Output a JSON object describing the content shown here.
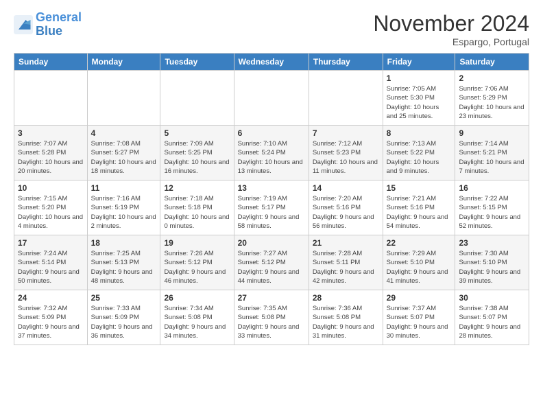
{
  "logo": {
    "line1": "General",
    "line2": "Blue"
  },
  "title": "November 2024",
  "location": "Espargo, Portugal",
  "days_header": [
    "Sunday",
    "Monday",
    "Tuesday",
    "Wednesday",
    "Thursday",
    "Friday",
    "Saturday"
  ],
  "weeks": [
    [
      {
        "day": "",
        "info": ""
      },
      {
        "day": "",
        "info": ""
      },
      {
        "day": "",
        "info": ""
      },
      {
        "day": "",
        "info": ""
      },
      {
        "day": "",
        "info": ""
      },
      {
        "day": "1",
        "info": "Sunrise: 7:05 AM\nSunset: 5:30 PM\nDaylight: 10 hours and 25 minutes."
      },
      {
        "day": "2",
        "info": "Sunrise: 7:06 AM\nSunset: 5:29 PM\nDaylight: 10 hours and 23 minutes."
      }
    ],
    [
      {
        "day": "3",
        "info": "Sunrise: 7:07 AM\nSunset: 5:28 PM\nDaylight: 10 hours and 20 minutes."
      },
      {
        "day": "4",
        "info": "Sunrise: 7:08 AM\nSunset: 5:27 PM\nDaylight: 10 hours and 18 minutes."
      },
      {
        "day": "5",
        "info": "Sunrise: 7:09 AM\nSunset: 5:25 PM\nDaylight: 10 hours and 16 minutes."
      },
      {
        "day": "6",
        "info": "Sunrise: 7:10 AM\nSunset: 5:24 PM\nDaylight: 10 hours and 13 minutes."
      },
      {
        "day": "7",
        "info": "Sunrise: 7:12 AM\nSunset: 5:23 PM\nDaylight: 10 hours and 11 minutes."
      },
      {
        "day": "8",
        "info": "Sunrise: 7:13 AM\nSunset: 5:22 PM\nDaylight: 10 hours and 9 minutes."
      },
      {
        "day": "9",
        "info": "Sunrise: 7:14 AM\nSunset: 5:21 PM\nDaylight: 10 hours and 7 minutes."
      }
    ],
    [
      {
        "day": "10",
        "info": "Sunrise: 7:15 AM\nSunset: 5:20 PM\nDaylight: 10 hours and 4 minutes."
      },
      {
        "day": "11",
        "info": "Sunrise: 7:16 AM\nSunset: 5:19 PM\nDaylight: 10 hours and 2 minutes."
      },
      {
        "day": "12",
        "info": "Sunrise: 7:18 AM\nSunset: 5:18 PM\nDaylight: 10 hours and 0 minutes."
      },
      {
        "day": "13",
        "info": "Sunrise: 7:19 AM\nSunset: 5:17 PM\nDaylight: 9 hours and 58 minutes."
      },
      {
        "day": "14",
        "info": "Sunrise: 7:20 AM\nSunset: 5:16 PM\nDaylight: 9 hours and 56 minutes."
      },
      {
        "day": "15",
        "info": "Sunrise: 7:21 AM\nSunset: 5:16 PM\nDaylight: 9 hours and 54 minutes."
      },
      {
        "day": "16",
        "info": "Sunrise: 7:22 AM\nSunset: 5:15 PM\nDaylight: 9 hours and 52 minutes."
      }
    ],
    [
      {
        "day": "17",
        "info": "Sunrise: 7:24 AM\nSunset: 5:14 PM\nDaylight: 9 hours and 50 minutes."
      },
      {
        "day": "18",
        "info": "Sunrise: 7:25 AM\nSunset: 5:13 PM\nDaylight: 9 hours and 48 minutes."
      },
      {
        "day": "19",
        "info": "Sunrise: 7:26 AM\nSunset: 5:12 PM\nDaylight: 9 hours and 46 minutes."
      },
      {
        "day": "20",
        "info": "Sunrise: 7:27 AM\nSunset: 5:12 PM\nDaylight: 9 hours and 44 minutes."
      },
      {
        "day": "21",
        "info": "Sunrise: 7:28 AM\nSunset: 5:11 PM\nDaylight: 9 hours and 42 minutes."
      },
      {
        "day": "22",
        "info": "Sunrise: 7:29 AM\nSunset: 5:10 PM\nDaylight: 9 hours and 41 minutes."
      },
      {
        "day": "23",
        "info": "Sunrise: 7:30 AM\nSunset: 5:10 PM\nDaylight: 9 hours and 39 minutes."
      }
    ],
    [
      {
        "day": "24",
        "info": "Sunrise: 7:32 AM\nSunset: 5:09 PM\nDaylight: 9 hours and 37 minutes."
      },
      {
        "day": "25",
        "info": "Sunrise: 7:33 AM\nSunset: 5:09 PM\nDaylight: 9 hours and 36 minutes."
      },
      {
        "day": "26",
        "info": "Sunrise: 7:34 AM\nSunset: 5:08 PM\nDaylight: 9 hours and 34 minutes."
      },
      {
        "day": "27",
        "info": "Sunrise: 7:35 AM\nSunset: 5:08 PM\nDaylight: 9 hours and 33 minutes."
      },
      {
        "day": "28",
        "info": "Sunrise: 7:36 AM\nSunset: 5:08 PM\nDaylight: 9 hours and 31 minutes."
      },
      {
        "day": "29",
        "info": "Sunrise: 7:37 AM\nSunset: 5:07 PM\nDaylight: 9 hours and 30 minutes."
      },
      {
        "day": "30",
        "info": "Sunrise: 7:38 AM\nSunset: 5:07 PM\nDaylight: 9 hours and 28 minutes."
      }
    ]
  ]
}
